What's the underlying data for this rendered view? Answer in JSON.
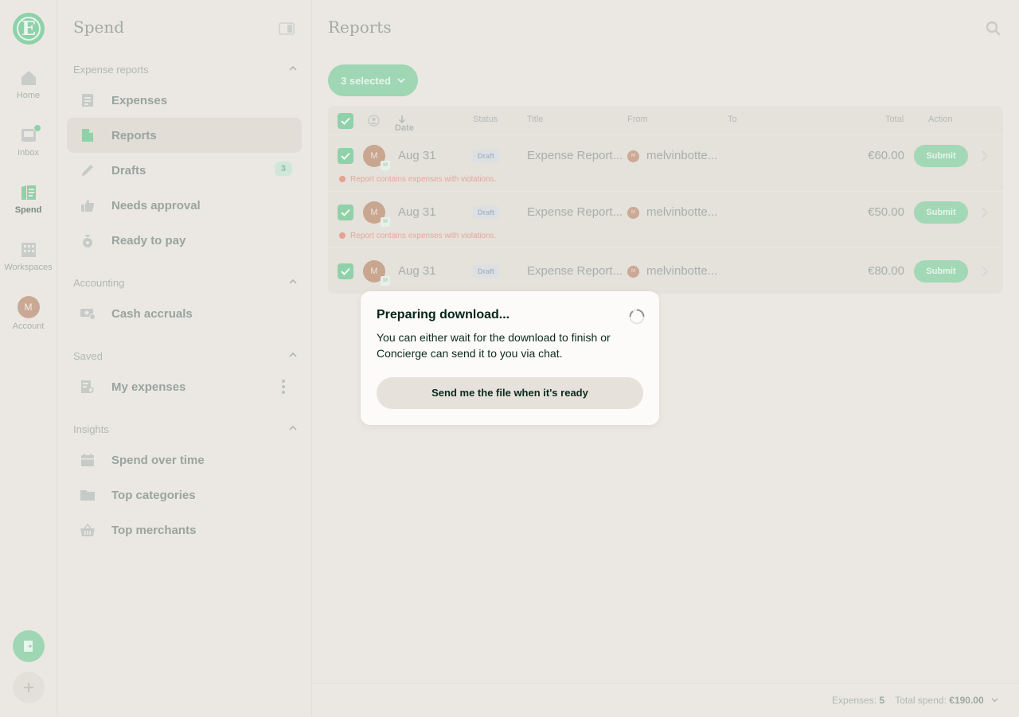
{
  "rail": {
    "logo": "E",
    "items": [
      {
        "label": "Home",
        "icon": "home-icon"
      },
      {
        "label": "Inbox",
        "icon": "inbox-icon"
      },
      {
        "label": "Spend",
        "icon": "spend-icon"
      },
      {
        "label": "Workspaces",
        "icon": "building-icon"
      },
      {
        "label": "Account",
        "avatar": "M"
      }
    ]
  },
  "sidebar": {
    "title": "Spend",
    "sections": {
      "expense_reports": {
        "label": "Expense reports",
        "items": [
          {
            "label": "Expenses"
          },
          {
            "label": "Reports"
          },
          {
            "label": "Drafts",
            "badge": "3"
          },
          {
            "label": "Needs approval"
          },
          {
            "label": "Ready to pay"
          }
        ]
      },
      "accounting": {
        "label": "Accounting",
        "items": [
          {
            "label": "Cash accruals"
          }
        ]
      },
      "saved": {
        "label": "Saved",
        "items": [
          {
            "label": "My expenses"
          }
        ]
      },
      "insights": {
        "label": "Insights",
        "items": [
          {
            "label": "Spend over time"
          },
          {
            "label": "Top categories"
          },
          {
            "label": "Top merchants"
          }
        ]
      }
    }
  },
  "main": {
    "title": "Reports",
    "selection_button": "3 selected",
    "columns": {
      "date": "Date",
      "status": "Status",
      "title": "Title",
      "from": "From",
      "to": "To",
      "total": "Total",
      "action": "Action"
    },
    "rows": [
      {
        "avatar": "M",
        "date": "Aug 31",
        "status": "Draft",
        "title": "Expense Report...",
        "from_avatar": "M",
        "from": "melvinbotte...",
        "total": "€60.00",
        "action": "Submit",
        "violation": "Report contains expenses with violations."
      },
      {
        "avatar": "M",
        "date": "Aug 31",
        "status": "Draft",
        "title": "Expense Report...",
        "from_avatar": "M",
        "from": "melvinbotte...",
        "total": "€50.00",
        "action": "Submit",
        "violation": "Report contains expenses with violations."
      },
      {
        "avatar": "M",
        "date": "Aug 31",
        "status": "Draft",
        "title": "Expense Report...",
        "from_avatar": "M",
        "from": "melvinbotte...",
        "total": "€80.00",
        "action": "Submit"
      }
    ]
  },
  "footer": {
    "expenses_label": "Expenses:",
    "expenses_count": "5",
    "total_label": "Total spend:",
    "total_value": "€190.00"
  },
  "modal": {
    "title": "Preparing download...",
    "body": "You can either wait for the download to finish or Concierge can send it to you via chat.",
    "button": "Send me the file when it's ready"
  },
  "colors": {
    "accent": "#8fd1a9",
    "background": "#ebe8e3",
    "violation": "#e8a08f",
    "modal_bg": "#fcfbf9"
  }
}
